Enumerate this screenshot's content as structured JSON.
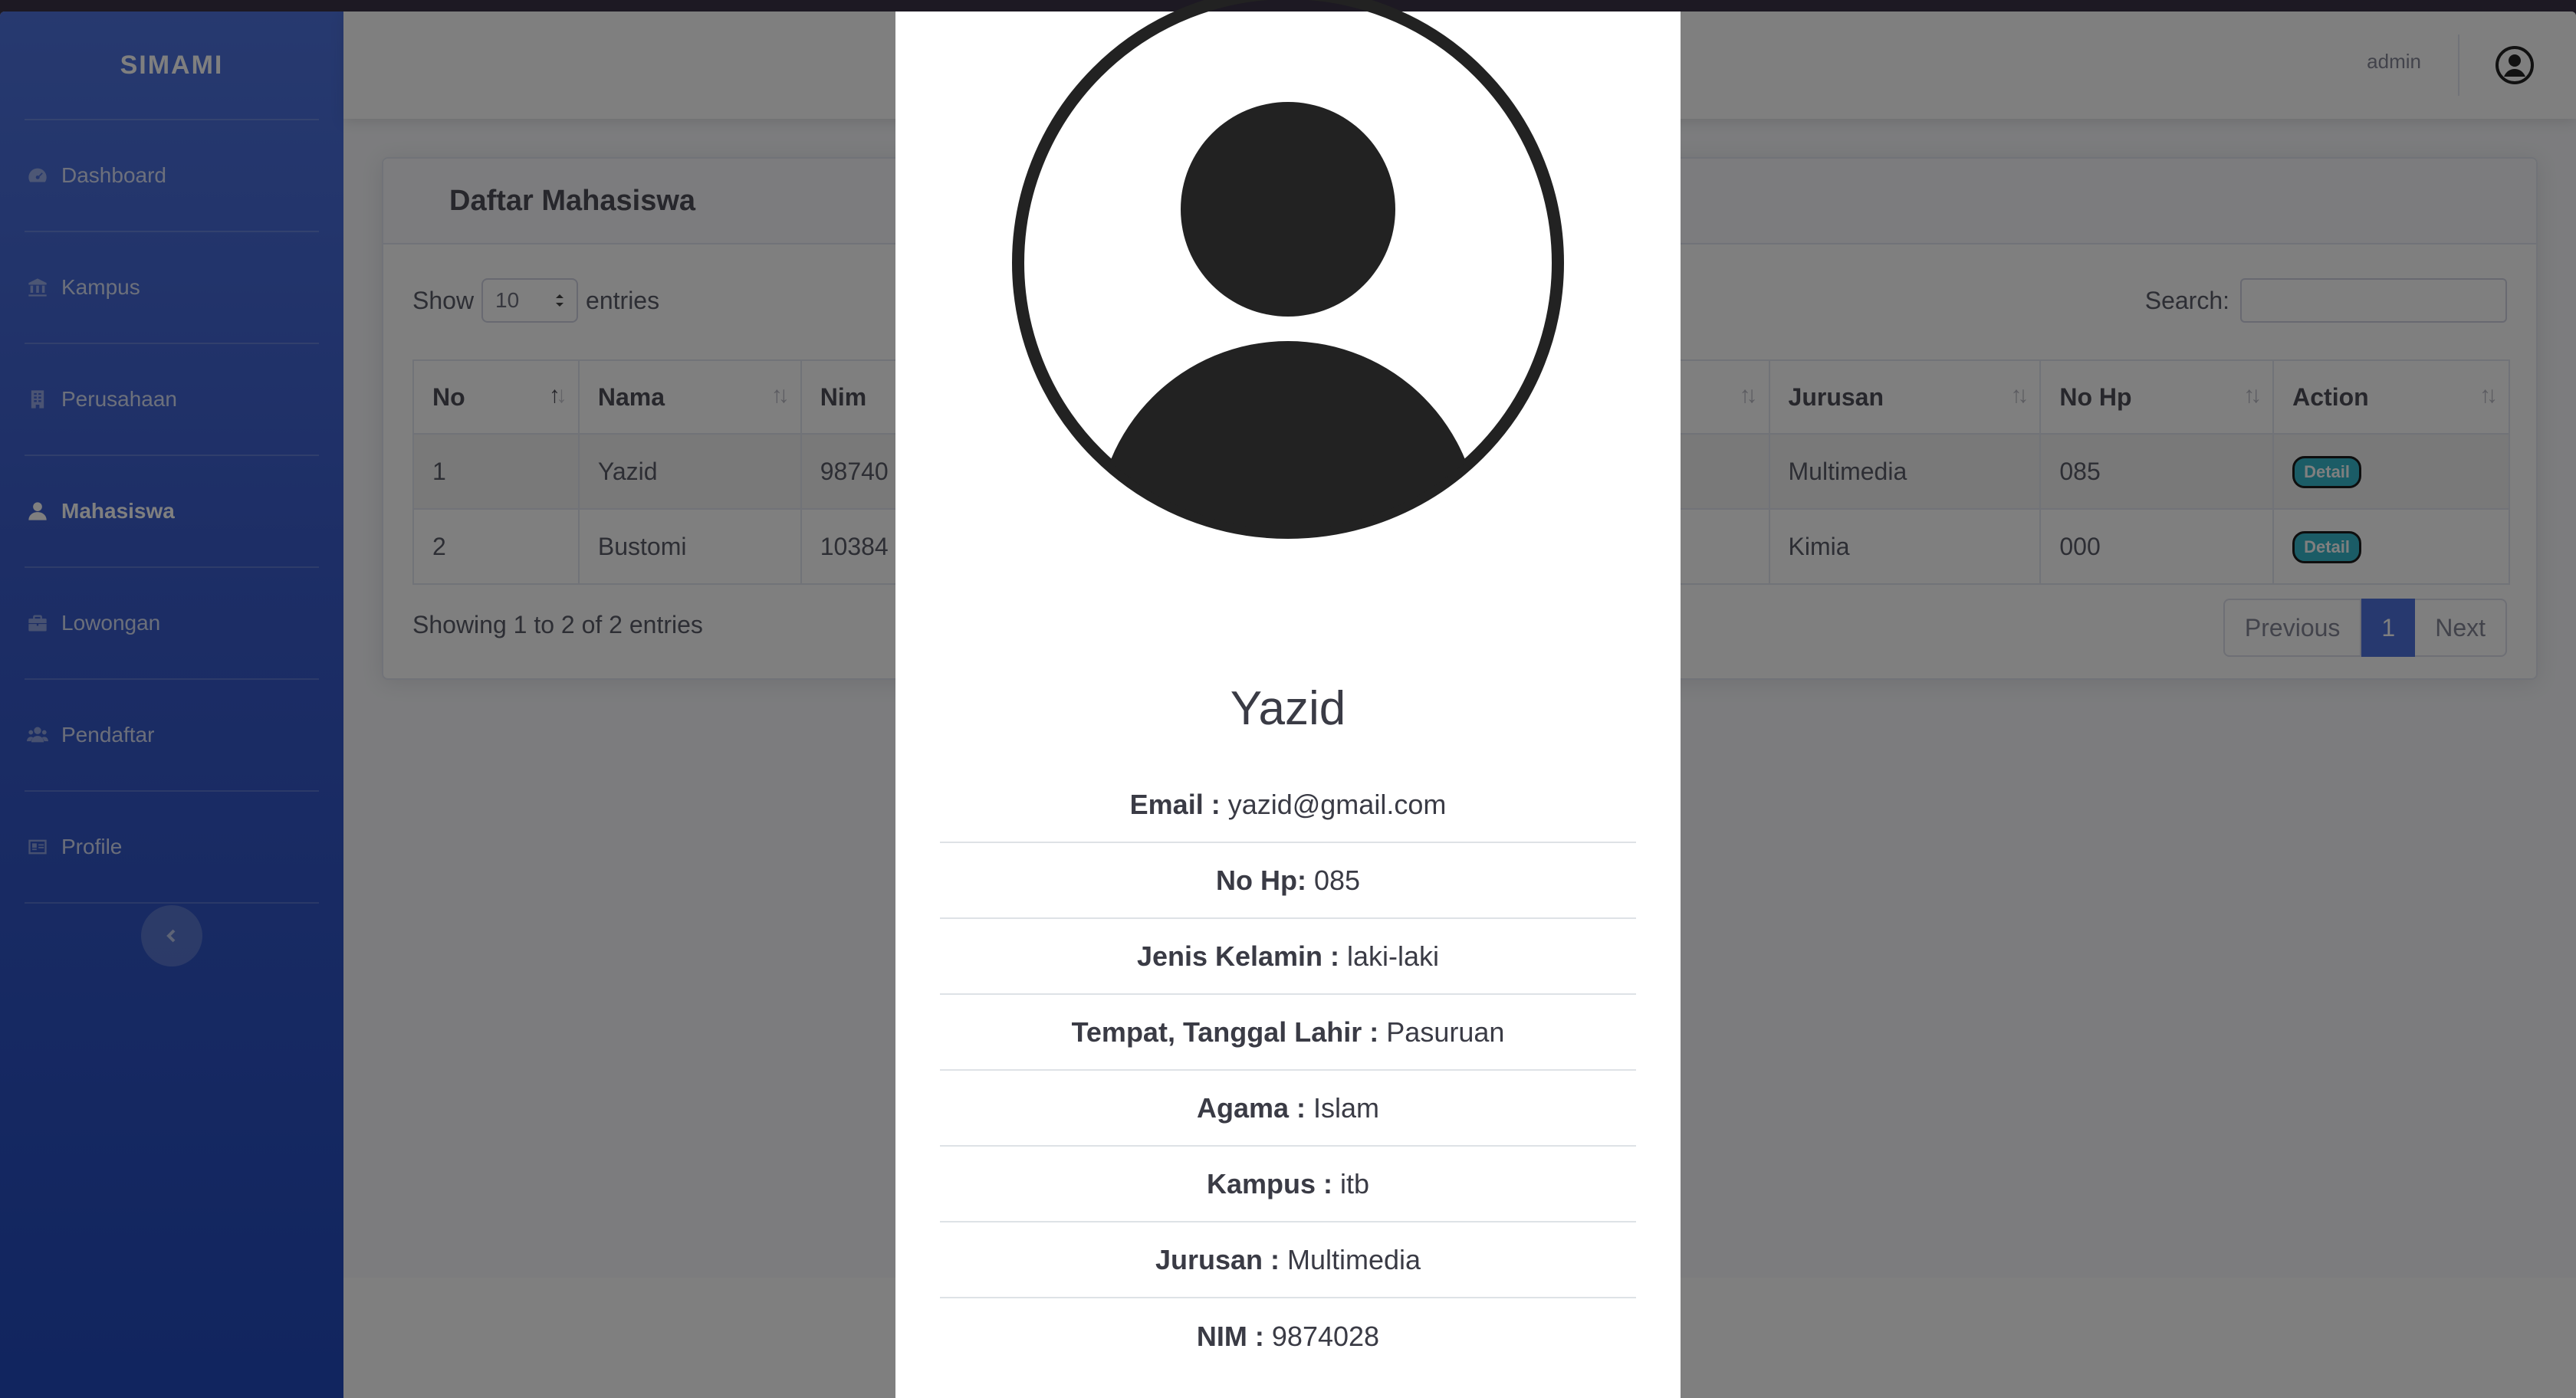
{
  "app": {
    "brand": "SIMAMI"
  },
  "sidebar": {
    "items": [
      {
        "label": "Dashboard",
        "icon": "tachometer-icon",
        "active": false
      },
      {
        "label": "Kampus",
        "icon": "university-icon",
        "active": false
      },
      {
        "label": "Perusahaan",
        "icon": "building-icon",
        "active": false
      },
      {
        "label": "Mahasiswa",
        "icon": "user-icon",
        "active": true
      },
      {
        "label": "Lowongan",
        "icon": "briefcase-icon",
        "active": false
      },
      {
        "label": "Pendaftar",
        "icon": "users-icon",
        "active": false
      },
      {
        "label": "Profile",
        "icon": "id-card-icon",
        "active": false
      }
    ],
    "toggle_icon": "chevron-left-icon"
  },
  "topbar": {
    "username": "admin",
    "user_icon": "user-circle-icon"
  },
  "card": {
    "title": "Daftar Mahasiswa",
    "show_label": "Show",
    "entries_value": "10",
    "entries_label": "entries",
    "search_label": "Search:",
    "search_value": "",
    "columns": [
      "No",
      "Nama",
      "Nim",
      "",
      "Jurusan",
      "No Hp",
      "Action"
    ],
    "rows": [
      {
        "no": "1",
        "nama": "Yazid",
        "nim": "98740",
        "jurusan": "Multimedia",
        "nohp": "085",
        "action": "Detail"
      },
      {
        "no": "2",
        "nama": "Bustomi",
        "nim": "10384",
        "jurusan": "Kimia",
        "nohp": "000",
        "action": "Detail"
      }
    ],
    "info": "Showing 1 to 2 of 2 entries",
    "pagination": {
      "previous": "Previous",
      "current": "1",
      "next": "Next"
    }
  },
  "modal": {
    "avatar_icon": "user-circle-icon",
    "name": "Yazid",
    "fields": [
      {
        "label": "Email :",
        "value": "yazid@gmail.com"
      },
      {
        "label": "No Hp:",
        "value": "085"
      },
      {
        "label": "Jenis Kelamin :",
        "value": "laki-laki"
      },
      {
        "label": "Tempat, Tanggal Lahir :",
        "value": "Pasuruan"
      },
      {
        "label": "Agama :",
        "value": "Islam"
      },
      {
        "label": "Kampus :",
        "value": "itb"
      },
      {
        "label": "Jurusan :",
        "value": "Multimedia"
      },
      {
        "label": "NIM :",
        "value": "9874028"
      }
    ]
  }
}
